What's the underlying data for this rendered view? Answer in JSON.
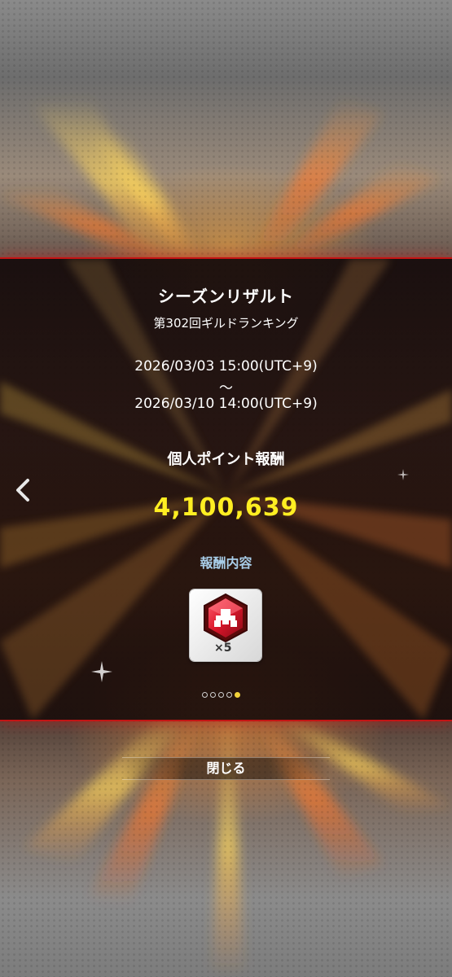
{
  "dialog": {
    "title": "シーズンリザルト",
    "subtitle": "第302回ギルドランキング",
    "period_start": "2026/03/03 15:00(UTC+9)",
    "period_separator": "〜",
    "period_end": "2026/03/10 14:00(UTC+9)",
    "points_label": "個人ポイント報酬",
    "points_value": "4,100,639",
    "rewards_label": "報酬内容",
    "reward_item": {
      "icon": "red-gem-icon",
      "quantity": "×5"
    },
    "pager": {
      "total": 5,
      "current": 5
    },
    "back_icon": "chevron-left-icon"
  },
  "footer": {
    "close_label": "閉じる"
  },
  "colors": {
    "accent_red": "#c41414",
    "points_yellow": "#ffee22",
    "rewards_blue": "#a8cde8",
    "pager_active": "#f2d23a"
  }
}
